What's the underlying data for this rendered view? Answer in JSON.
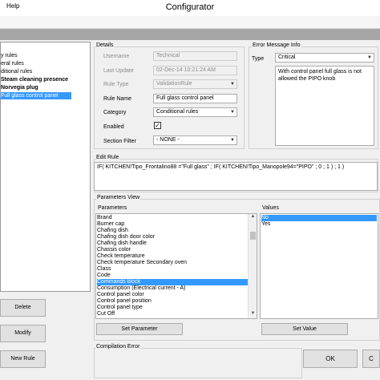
{
  "window": {
    "title": "Configurator"
  },
  "menu": {
    "help": "Help"
  },
  "tree": {
    "items": [
      {
        "label": "y rules",
        "bold": false,
        "selected": false
      },
      {
        "label": "eral rules",
        "bold": false,
        "selected": false
      },
      {
        "label": "ditional rules",
        "bold": false,
        "selected": false
      },
      {
        "label": "Steam cleaning presence",
        "bold": true,
        "selected": false
      },
      {
        "label": "Norvegia plug",
        "bold": true,
        "selected": false
      },
      {
        "label": "Full glass control panel",
        "bold": false,
        "selected": true
      }
    ]
  },
  "left_buttons": {
    "delete": "Delete",
    "modify": "Modify",
    "new_rule": "New Rule"
  },
  "details": {
    "group_label": "Details",
    "username_label": "Username",
    "username_value": "Technical",
    "last_update_label": "Last Update",
    "last_update_value": "02-Dec-14 10:21:24 AM",
    "rule_type_label": "Rule Type",
    "rule_type_value": "ValidationRule",
    "rule_name_label": "Rule Name",
    "rule_name_value": "Full glass control panel",
    "category_label": "Category",
    "category_value": "Conditional rules",
    "enabled_label": "Enabled",
    "enabled_checked": true,
    "section_filter_label": "Section Filter",
    "section_filter_value": "- NONE -"
  },
  "error_info": {
    "group_label": "Error Message Info",
    "type_label": "Type",
    "type_value": "Critical",
    "message": "With control panel full glass is not allowed the PIPO knob"
  },
  "edit_rule": {
    "group_label": "Edit Rule",
    "expression": "IF( KITCHEN!Tipo_Frontalino88 =\"Full glass\" ; IF( KITCHEN!Tipo_Manopole94=\"PIPO\" ; 0 ; 1 ) ; 1 )"
  },
  "params_view": {
    "group_label": "Parameters View",
    "parameters_label": "Parameters",
    "values_label": "Values",
    "parameters": [
      "Brand",
      "Burner cap",
      "Chafing dish",
      "Chafing dish door color",
      "Chafing dish handle",
      "Chassis color",
      "Check temperature",
      "Check temperature Secondary oven",
      "Class",
      "Code",
      "Commands block",
      "Consumption (Electrical current - A)",
      "Control panel color",
      "Control panel position",
      "Control panel type",
      "Cut Off"
    ],
    "selected_parameter": "Commands block",
    "values": [
      "No",
      "Yes"
    ],
    "selected_value": "No",
    "set_parameter": "Set Parameter",
    "set_value": "Set Value"
  },
  "compilation": {
    "group_label": "Compilation Error",
    "ok": "OK",
    "cancel": "C"
  }
}
